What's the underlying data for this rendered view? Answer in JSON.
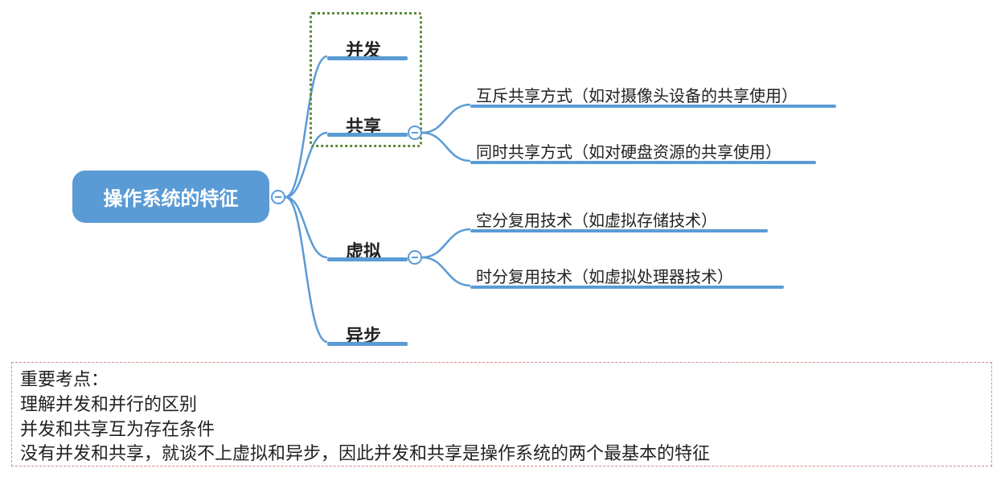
{
  "root": {
    "label": "操作系统的特征"
  },
  "children": [
    {
      "label": "并发"
    },
    {
      "label": "共享",
      "children": [
        {
          "label": "互斥共享方式（如对摄像头设备的共享使用）"
        },
        {
          "label": "同时共享方式（如对硬盘资源的共享使用）"
        }
      ]
    },
    {
      "label": "虚拟",
      "children": [
        {
          "label": "空分复用技术（如虚拟存储技术）"
        },
        {
          "label": "时分复用技术（如虚拟处理器技术）"
        }
      ]
    },
    {
      "label": "异步"
    }
  ],
  "notes": {
    "title": "重要考点：",
    "lines": [
      "理解并发和并行的区别",
      "并发和共享互为存在条件",
      "没有并发和共享，就谈不上虚拟和异步，因此并发和共享是操作系统的两个最基本的特征"
    ]
  }
}
